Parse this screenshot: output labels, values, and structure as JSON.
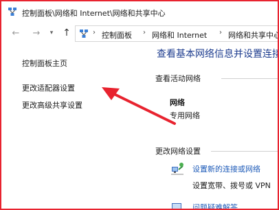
{
  "window": {
    "title": "控制面板\\网络和 Internet\\网络和共享中心"
  },
  "nav": {
    "back_icon": "arrow-left-icon",
    "forward_icon": "arrow-right-icon",
    "recent_icon": "chevron-down-icon",
    "up_icon": "arrow-up-icon",
    "breadcrumbs": [
      "控制面板",
      "网络和 Internet",
      "网络和共享中心"
    ]
  },
  "sidebar": {
    "items": [
      {
        "label": "控制面板主页"
      },
      {
        "label": "更改适配器设置"
      },
      {
        "label": "更改高级共享设置"
      }
    ]
  },
  "main": {
    "heading": "查看基本网络信息并设置连接",
    "active_networks_heading": "查看活动网络",
    "network_name": "网络",
    "network_type": "专用网络",
    "change_settings_heading": "更改网络设置",
    "setup_link": "设置新的连接或网络",
    "setup_description": "设置宽带、拨号或 VPN",
    "troubleshoot_link": "问题疑难解答"
  },
  "colors": {
    "annotation": "#e8232f",
    "heading": "#1e3d8f",
    "link": "#1e5bb8"
  }
}
